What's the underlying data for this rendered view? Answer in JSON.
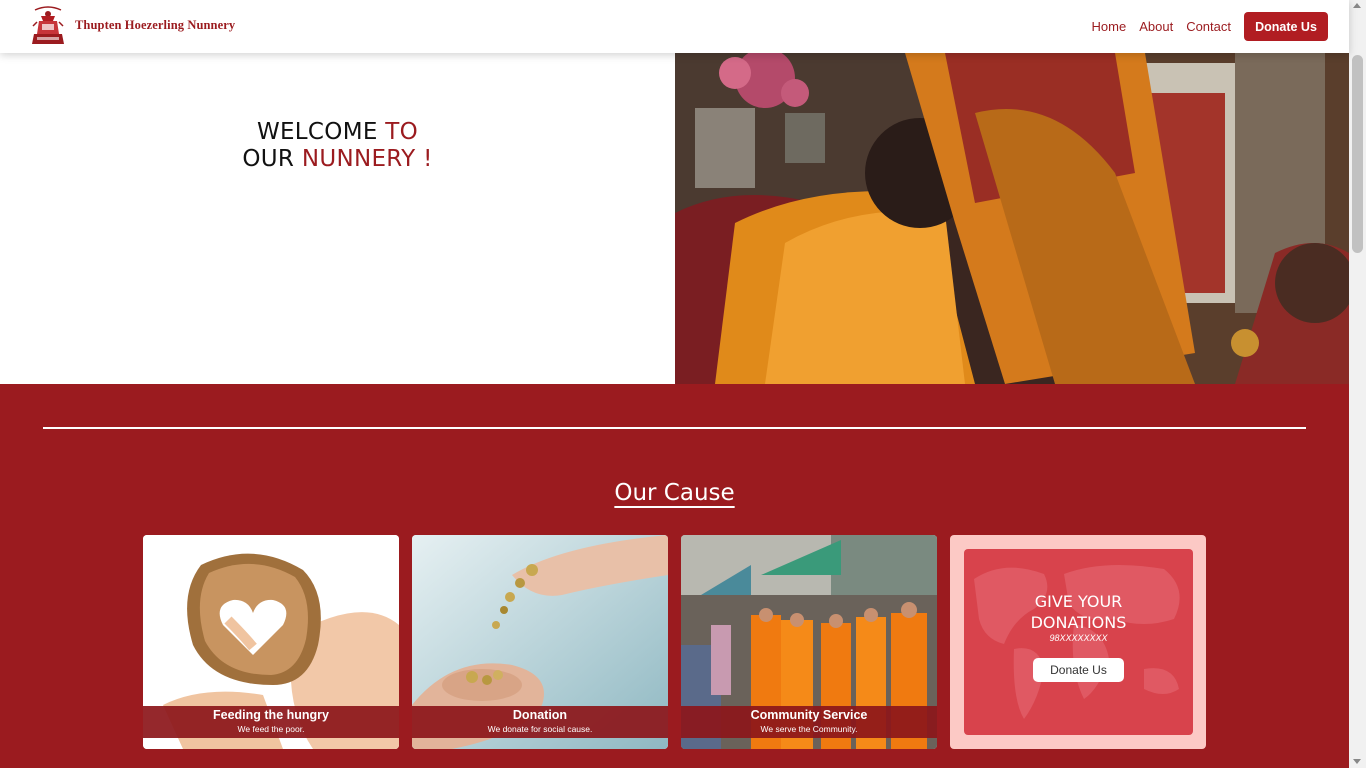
{
  "nav": {
    "brand": "Thupten Hoezerling Nunnery",
    "links": [
      "Home",
      "About",
      "Contact"
    ],
    "donate_label": "Donate Us"
  },
  "hero": {
    "line1_a": "WELCOME ",
    "line1_b": "TO",
    "line2_a": "OUR ",
    "line2_b": "NUNNERY !"
  },
  "cause": {
    "title": "Our Cause",
    "cards": [
      {
        "title": "Feeding the hungry",
        "subtitle": "We feed the poor."
      },
      {
        "title": "Donation",
        "subtitle": "We donate for social cause."
      },
      {
        "title": "Community Service",
        "subtitle": "We serve the Community."
      }
    ],
    "donation_box": {
      "title_line1": "GIVE YOUR",
      "title_line2": "DONATIONS",
      "phone": "98XXXXXXXX",
      "button_label": "Donate Us"
    }
  },
  "colors": {
    "brand_red": "#9b1b1f",
    "button_red": "#b11d22",
    "donate_bg": "#fcc9c5",
    "donate_inner": "#d8434c"
  }
}
